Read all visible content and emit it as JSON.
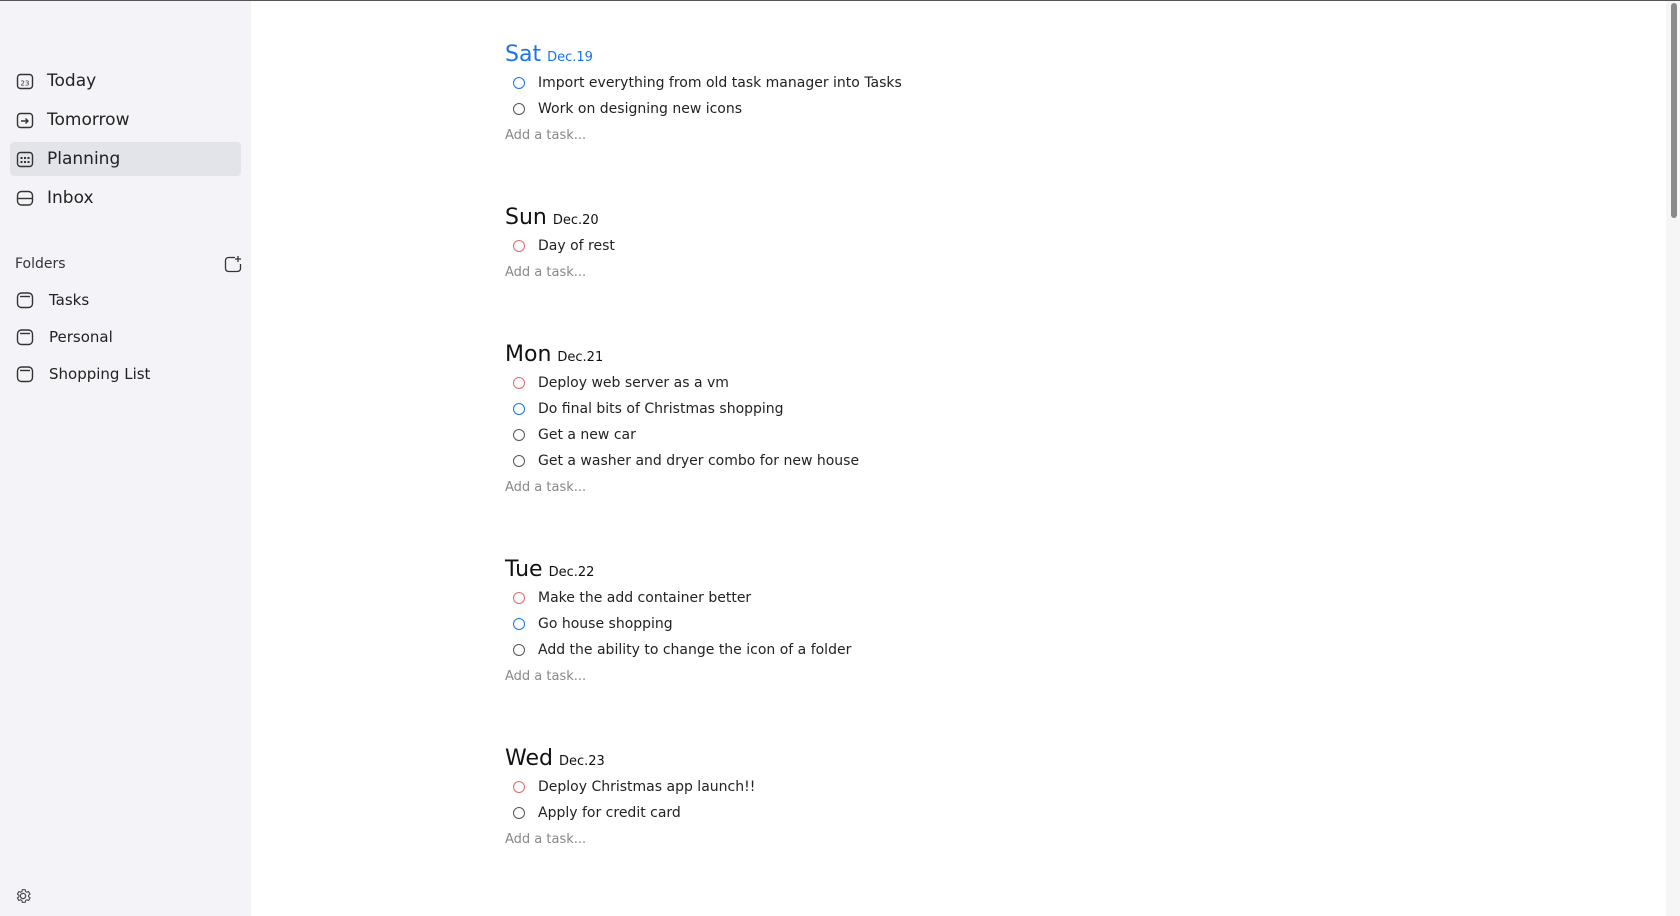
{
  "sidebar": {
    "nav": [
      {
        "label": "Today",
        "icon": "calendar-today-icon"
      },
      {
        "label": "Tomorrow",
        "icon": "calendar-arrow-icon"
      },
      {
        "label": "Planning",
        "icon": "calendar-grid-icon",
        "active": true
      },
      {
        "label": "Inbox",
        "icon": "inbox-icon"
      }
    ],
    "today_icon_number": "23",
    "folders_title": "Folders",
    "folders": [
      {
        "label": "Tasks",
        "icon": "folder-icon"
      },
      {
        "label": "Personal",
        "icon": "folder-icon"
      },
      {
        "label": "Shopping List",
        "icon": "folder-icon"
      }
    ]
  },
  "main": {
    "add_task_placeholder": "Add a task...",
    "days": [
      {
        "name": "Sat",
        "date": "Dec.19",
        "today": true,
        "tasks": [
          {
            "text": "Import everything from old task manager into Tasks",
            "priority": "blue"
          },
          {
            "text": "Work on designing new icons",
            "priority": "gray"
          }
        ]
      },
      {
        "name": "Sun",
        "date": "Dec.20",
        "tasks": [
          {
            "text": "Day of rest",
            "priority": "red"
          }
        ]
      },
      {
        "name": "Mon",
        "date": "Dec.21",
        "tasks": [
          {
            "text": "Deploy web server as a vm",
            "priority": "red"
          },
          {
            "text": "Do final bits of Christmas shopping",
            "priority": "blue"
          },
          {
            "text": "Get a new car",
            "priority": "gray"
          },
          {
            "text": "Get a washer and dryer combo for new house",
            "priority": "gray"
          }
        ]
      },
      {
        "name": "Tue",
        "date": "Dec.22",
        "tasks": [
          {
            "text": "Make the add container better",
            "priority": "red"
          },
          {
            "text": "Go house shopping",
            "priority": "blue"
          },
          {
            "text": "Add the ability to change the icon of a folder",
            "priority": "gray"
          }
        ]
      },
      {
        "name": "Wed",
        "date": "Dec.23",
        "tasks": [
          {
            "text": "Deploy Christmas app launch!!",
            "priority": "red"
          },
          {
            "text": "Apply for credit card",
            "priority": "gray"
          }
        ]
      }
    ]
  },
  "colors": {
    "accent": "#1a73e8",
    "red": "#e06a6a",
    "sidebar_bg": "#f4f4f8",
    "active_bg": "#e3e3ea"
  }
}
